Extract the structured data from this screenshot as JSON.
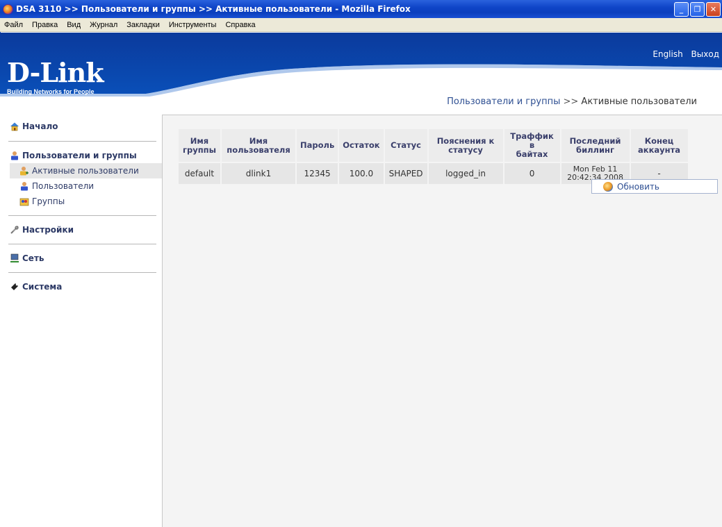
{
  "window": {
    "title": "DSA 3110 >> Пользователи и группы >> Активные пользователи - Mozilla Firefox"
  },
  "menubar": {
    "items": [
      "Файл",
      "Правка",
      "Вид",
      "Журнал",
      "Закладки",
      "Инструменты",
      "Справка"
    ]
  },
  "header": {
    "logo": "D-Link",
    "tagline": "Building Networks for People",
    "links": {
      "english": "English",
      "logout": "Выход"
    },
    "breadcrumb": {
      "parent": "Пользователи и группы",
      "separator": ">>",
      "current": "Активные пользователи"
    }
  },
  "sidebar": {
    "home": "Начало",
    "users_groups": "Пользователи и группы",
    "sub": {
      "active_users": "Активные пользователи",
      "users": "Пользователи",
      "groups": "Группы"
    },
    "settings": "Настройки",
    "network": "Сеть",
    "system": "Система"
  },
  "table": {
    "headers": {
      "group": [
        "Имя",
        "группы"
      ],
      "user": [
        "Имя",
        "пользователя"
      ],
      "password": "Пароль",
      "remaining": "Остаток",
      "status": "Статус",
      "status_note": [
        "Пояснения к",
        "статусу"
      ],
      "traffic": [
        "Траффик в",
        "байтах"
      ],
      "last_billing": [
        "Последний",
        "биллинг"
      ],
      "account_end": [
        "Конец",
        "аккаунта"
      ]
    },
    "rows": [
      {
        "group": "default",
        "user": "dlink1",
        "password": "12345",
        "remaining": "100.0",
        "status": "SHAPED",
        "status_note": "logged_in",
        "traffic": "0",
        "last_billing": [
          "Mon Feb 11",
          "20:42:34 2008"
        ],
        "account_end": "-"
      }
    ],
    "refresh_label": "Обновить"
  },
  "colors": {
    "header_blue": "#0a3fa6",
    "title_bar": "#0b3fbd",
    "nav_text": "#2d3a66"
  }
}
